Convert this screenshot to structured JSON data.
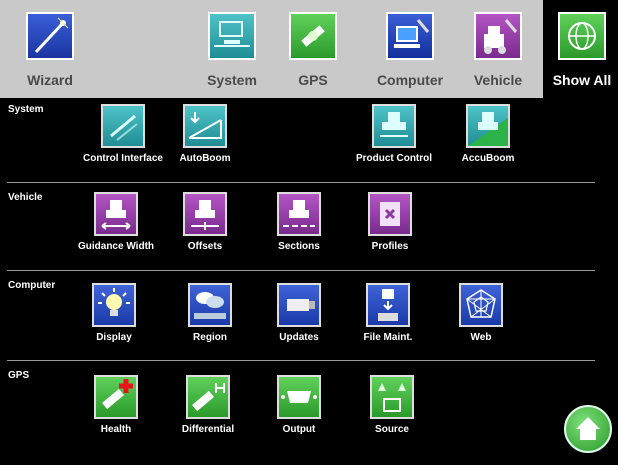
{
  "toolbar": {
    "wizard": "Wizard",
    "system": "System",
    "gps": "GPS",
    "computer": "Computer",
    "vehicle": "Vehicle",
    "show_all": "Show All"
  },
  "sections": {
    "system": {
      "label": "System",
      "items": [
        "Control Interface",
        "AutoBoom",
        "Product Control",
        "AccuBoom"
      ]
    },
    "vehicle": {
      "label": "Vehicle",
      "items": [
        "Guidance Width",
        "Offsets",
        "Sections",
        "Profiles"
      ]
    },
    "computer": {
      "label": "Computer",
      "items": [
        "Display",
        "Region",
        "Updates",
        "File Maint.",
        "Web"
      ]
    },
    "gps": {
      "label": "GPS",
      "items": [
        "Health",
        "Differential",
        "Output",
        "Source"
      ]
    }
  },
  "colors": {
    "topbar_bg": "#c9c9c9",
    "system": "#2a9aa0",
    "vehicle": "#8e3aa3",
    "computer": "#1f43b8",
    "gps": "#35ad33"
  }
}
